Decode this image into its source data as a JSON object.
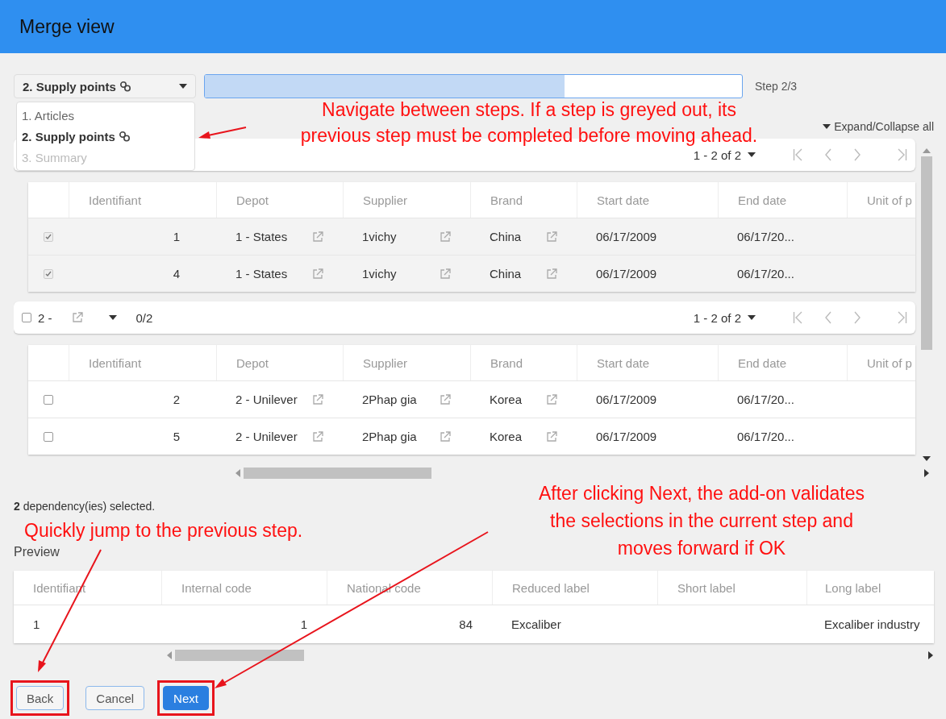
{
  "window": {
    "title": "Merge view"
  },
  "step_selector": {
    "value": "2. Supply points",
    "linked": true,
    "menu": [
      {
        "label": "1. Articles",
        "selected": false,
        "disabled": false,
        "linked": false
      },
      {
        "label": "2. Supply points",
        "selected": true,
        "disabled": false,
        "linked": true
      },
      {
        "label": "3. Summary",
        "selected": false,
        "disabled": true,
        "linked": false
      }
    ]
  },
  "progress": {
    "level": 0.67,
    "label": "Step 2/3"
  },
  "expand_collapse": "Expand/Collapse all",
  "groups": [
    {
      "pager": "1 - 2 of 2",
      "columns": [
        {
          "label": "Identifiant",
          "kind": "number"
        },
        {
          "label": "Depot",
          "kind": "link"
        },
        {
          "label": "Supplier",
          "kind": "link"
        },
        {
          "label": "Brand",
          "kind": "link"
        },
        {
          "label": "Start date",
          "kind": "text"
        },
        {
          "label": "End date",
          "kind": "text"
        },
        {
          "label": "Unit of p"
        }
      ],
      "rows": [
        {
          "checked": true,
          "cells": [
            "1",
            "1 - States",
            "1vichy",
            "China",
            "06/17/2009",
            "06/17/20..."
          ]
        },
        {
          "checked": true,
          "cells": [
            "4",
            "1 - States",
            "1vichy",
            "China",
            "06/17/2009",
            "06/17/20..."
          ]
        }
      ]
    },
    {
      "checked": false,
      "label": "2 -",
      "count": "0/2",
      "pager": "1 - 2 of 2",
      "columns": [
        {
          "label": "Identifiant",
          "kind": "number"
        },
        {
          "label": "Depot",
          "kind": "link"
        },
        {
          "label": "Supplier",
          "kind": "link"
        },
        {
          "label": "Brand",
          "kind": "link"
        },
        {
          "label": "Start date",
          "kind": "text"
        },
        {
          "label": "End date",
          "kind": "text"
        },
        {
          "label": "Unit of p"
        }
      ],
      "rows": [
        {
          "checked": false,
          "cells": [
            "2",
            "2 - Unilever",
            "2Phap gia",
            "Korea",
            "06/17/2009",
            "06/17/20..."
          ]
        },
        {
          "checked": false,
          "cells": [
            "5",
            "2 - Unilever",
            "2Phap gia",
            "Korea",
            "06/17/2009",
            "06/17/20..."
          ]
        }
      ]
    }
  ],
  "selection_summary": "**2** dependency(ies) selected.",
  "preview": {
    "title": "Preview",
    "columns": [
      {
        "label": "Identifiant",
        "kind": "text"
      },
      {
        "label": "Internal code",
        "kind": "number"
      },
      {
        "label": "National code",
        "kind": "number"
      },
      {
        "label": "Reduced label",
        "kind": "text"
      },
      {
        "label": "Short label",
        "kind": "text"
      },
      {
        "label": "Long label",
        "kind": "text"
      }
    ],
    "rows": [
      {
        "cells": [
          "1",
          "1",
          "84",
          "Excaliber",
          "",
          "Excaliber industry"
        ]
      }
    ]
  },
  "buttons": [
    {
      "label": "Back",
      "kind": "secondary",
      "highlighted": true
    },
    {
      "label": "Cancel",
      "kind": "secondary",
      "highlighted": false
    },
    {
      "label": "Next",
      "kind": "primary",
      "highlighted": true
    }
  ],
  "annotations": [
    "Navigate between steps. If a step is greyed out, its previous step must be completed before moving ahead.",
    "Quickly jump to the previous step.",
    "After clicking Next, the add-on validates the selections in the current step and moves forward if OK"
  ]
}
